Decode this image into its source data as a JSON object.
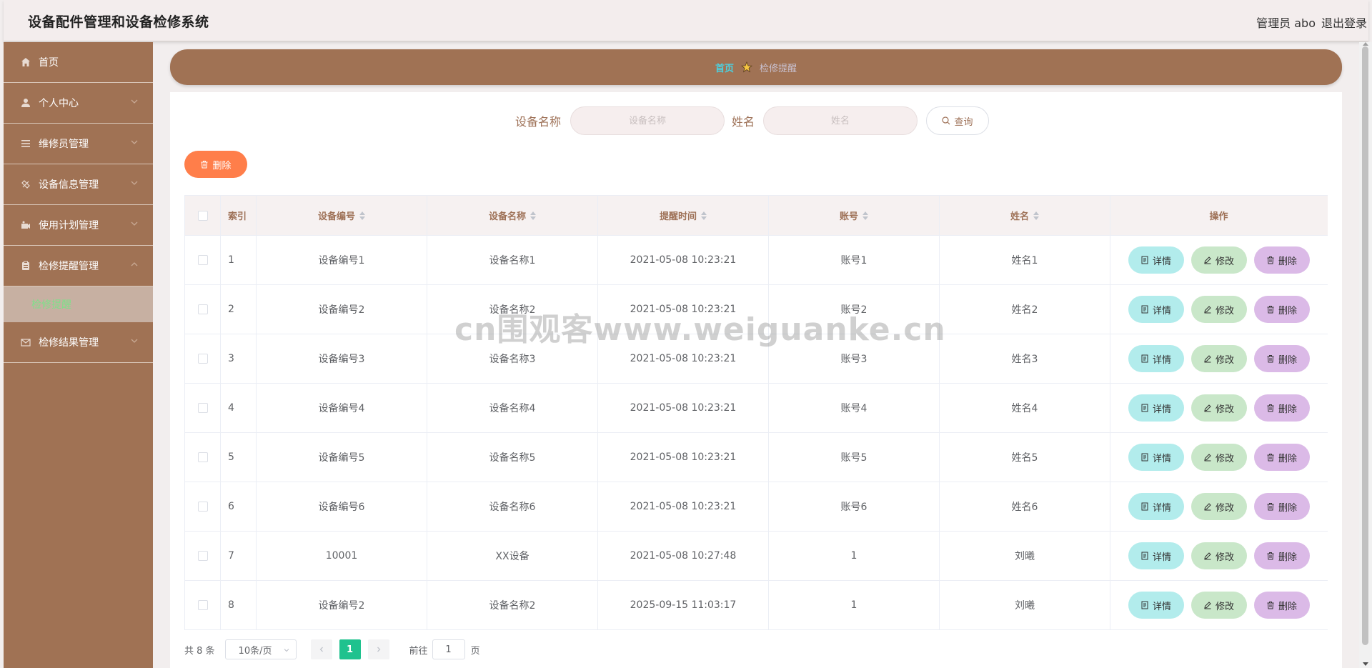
{
  "app": {
    "title": "设备配件管理和设备检修系统",
    "user": "管理员 abo",
    "logout": "退出登录"
  },
  "sidebar": {
    "items": [
      {
        "label": "首页",
        "icon": "home-icon"
      },
      {
        "label": "个人中心",
        "icon": "user-icon"
      },
      {
        "label": "维修员管理",
        "icon": "list-icon"
      },
      {
        "label": "设备信息管理",
        "icon": "slash-icon"
      },
      {
        "label": "使用计划管理",
        "icon": "camera-icon"
      },
      {
        "label": "检修提醒管理",
        "icon": "clipboard-icon"
      },
      {
        "label": "检修结果管理",
        "icon": "mail-icon"
      }
    ],
    "submenu": {
      "label": "检修提醒"
    }
  },
  "breadcrumb": {
    "home": "首页",
    "current": "检修提醒"
  },
  "search": {
    "device_label": "设备名称",
    "device_placeholder": "设备名称",
    "name_label": "姓名",
    "name_placeholder": "姓名",
    "query": "查询"
  },
  "toolbar": {
    "delete": "删除"
  },
  "table": {
    "headers": [
      "索引",
      "设备编号",
      "设备名称",
      "提醒时间",
      "账号",
      "姓名",
      "操作"
    ],
    "rows": [
      {
        "idx": "1",
        "code": "设备编号1",
        "name": "设备名称1",
        "time": "2021-05-08 10:23:21",
        "account": "账号1",
        "person": "姓名1"
      },
      {
        "idx": "2",
        "code": "设备编号2",
        "name": "设备名称2",
        "time": "2021-05-08 10:23:21",
        "account": "账号2",
        "person": "姓名2"
      },
      {
        "idx": "3",
        "code": "设备编号3",
        "name": "设备名称3",
        "time": "2021-05-08 10:23:21",
        "account": "账号3",
        "person": "姓名3"
      },
      {
        "idx": "4",
        "code": "设备编号4",
        "name": "设备名称4",
        "time": "2021-05-08 10:23:21",
        "account": "账号4",
        "person": "姓名4"
      },
      {
        "idx": "5",
        "code": "设备编号5",
        "name": "设备名称5",
        "time": "2021-05-08 10:23:21",
        "account": "账号5",
        "person": "姓名5"
      },
      {
        "idx": "6",
        "code": "设备编号6",
        "name": "设备名称6",
        "time": "2021-05-08 10:23:21",
        "account": "账号6",
        "person": "姓名6"
      },
      {
        "idx": "7",
        "code": "10001",
        "name": "XX设备",
        "time": "2021-05-08 10:27:48",
        "account": "1",
        "person": "刘曦"
      },
      {
        "idx": "8",
        "code": "设备编号2",
        "name": "设备名称2",
        "time": "2025-09-15 11:03:17",
        "account": "1",
        "person": "刘曦"
      }
    ],
    "actions": {
      "detail": "详情",
      "edit": "修改",
      "delete": "删除"
    }
  },
  "pagination": {
    "total": "共 8 条",
    "page_size": "10条/页",
    "current": "1",
    "goto_prefix": "前往",
    "goto_value": "1",
    "goto_suffix": "页"
  },
  "watermark": "cn围观客www.weiguanke.cn",
  "colors": {
    "sidebar": "#a07254",
    "accent_text": "#9e7157",
    "delete_button": "#ff7e4a",
    "detail_button": "#b2ecec",
    "edit_button": "#c9e7c9",
    "row_delete_button": "#dbbae7",
    "page_active": "#1fc28e"
  }
}
